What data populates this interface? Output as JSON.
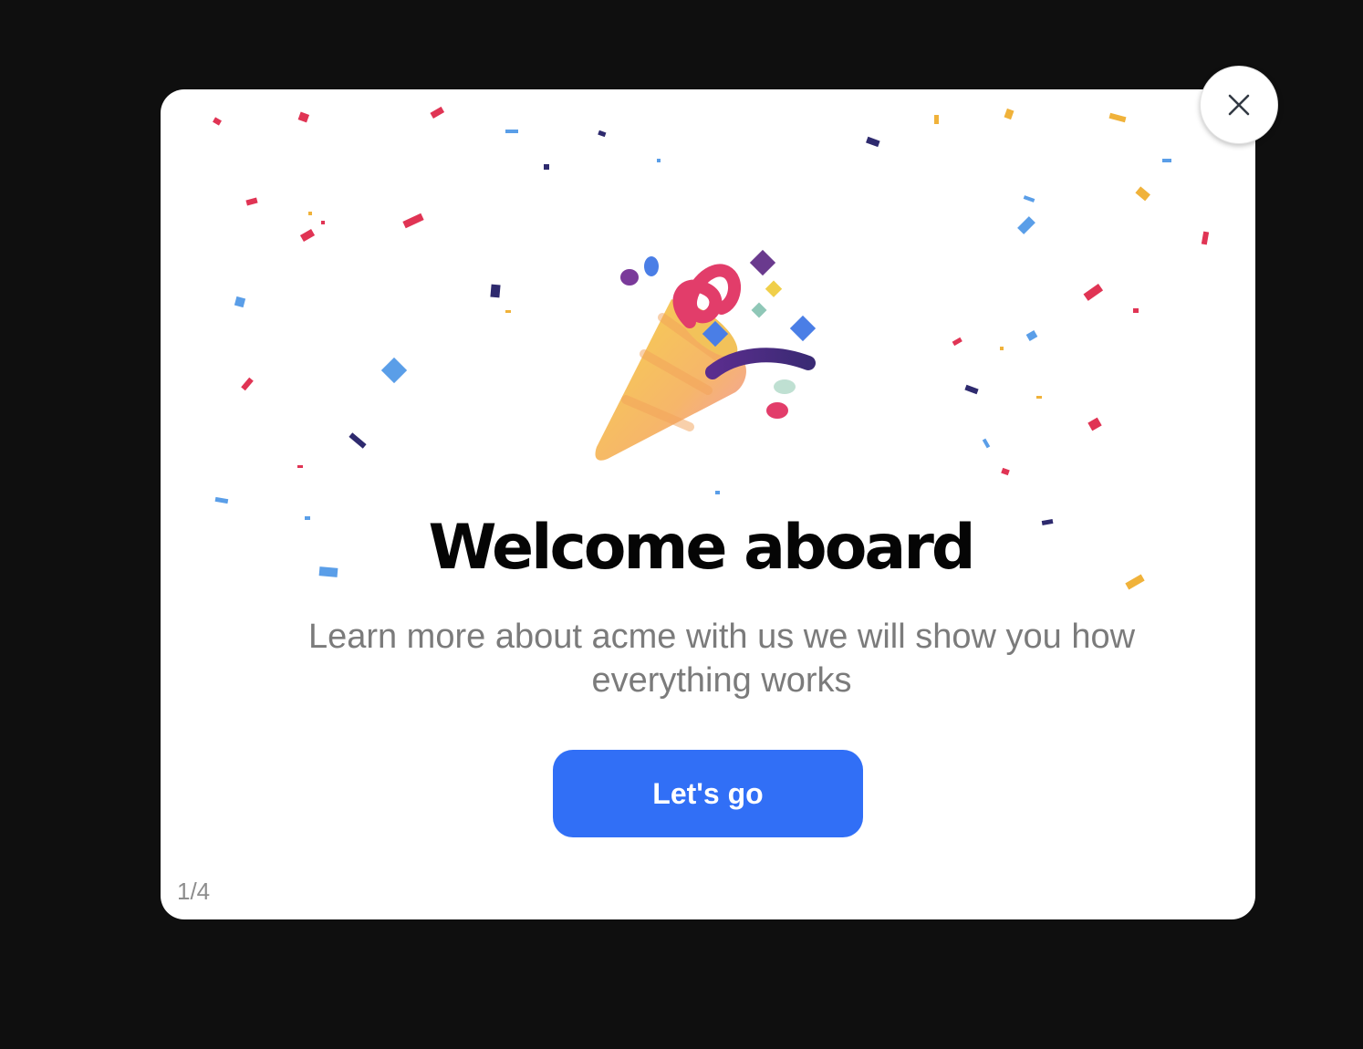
{
  "modal": {
    "title": "Welcome aboard",
    "description": "Learn more about acme with us we will show you how everything works",
    "cta_label": "Let's go",
    "step_indicator": "1/4",
    "illustration": "party-popper-icon",
    "close_icon": "close-icon"
  },
  "colors": {
    "backdrop": "#0f0f0f",
    "modal_background": "#ffffff",
    "cta_background": "#316ff6",
    "cta_text": "#ffffff",
    "title_text": "#050505",
    "description_text": "#7b7b7b",
    "step_text": "#8d8d8d",
    "close_icon": "#333a44"
  }
}
